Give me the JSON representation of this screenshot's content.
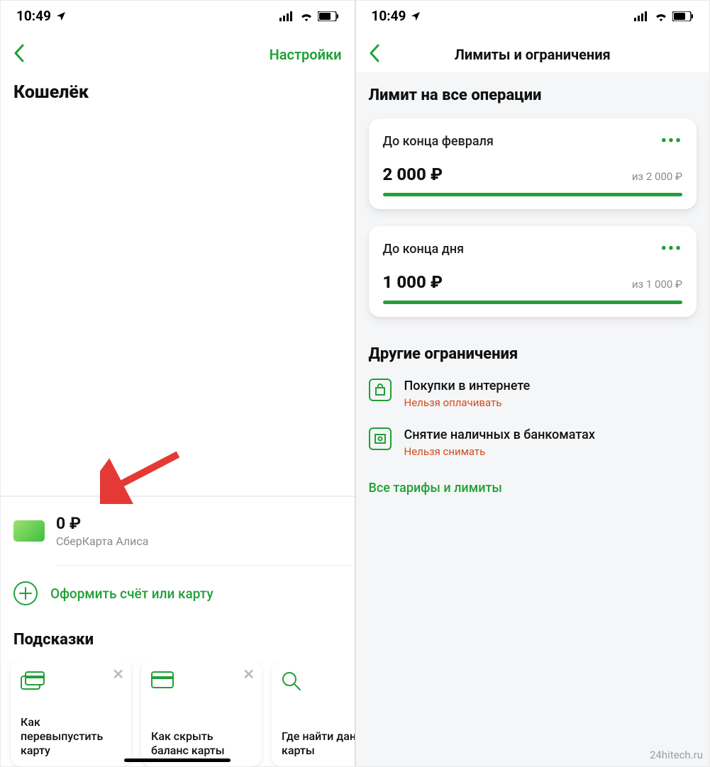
{
  "status": {
    "time": "10:49"
  },
  "left": {
    "nav": {
      "settings_label": "Настройки"
    },
    "title": "Кошелёк",
    "card": {
      "balance": "0 ₽",
      "name": "СберКарта Алиса"
    },
    "action": {
      "label": "Оформить счёт или карту"
    },
    "hints_title": "Подсказки",
    "hints": [
      {
        "text": "Как перевыпустить карту"
      },
      {
        "text": "Как скрыть баланс карты"
      },
      {
        "text": "Где найти данные карты"
      }
    ]
  },
  "right": {
    "nav_title": "Лимиты и ограничения",
    "main_title": "Лимит на все операции",
    "limits": [
      {
        "period": "До конца февраля",
        "amount": "2 000 ₽",
        "of": "из 2 000 ₽"
      },
      {
        "period": "До конца дня",
        "amount": "1 000 ₽",
        "of": "из 1 000 ₽"
      }
    ],
    "other_title": "Другие ограничения",
    "restrictions": [
      {
        "name": "Покупки в интернете",
        "status": "Нельзя оплачивать"
      },
      {
        "name": "Снятие наличных в банкоматах",
        "status": "Нельзя снимать"
      }
    ],
    "all_link": "Все тарифы и лимиты"
  },
  "watermark": "24hitech.ru"
}
